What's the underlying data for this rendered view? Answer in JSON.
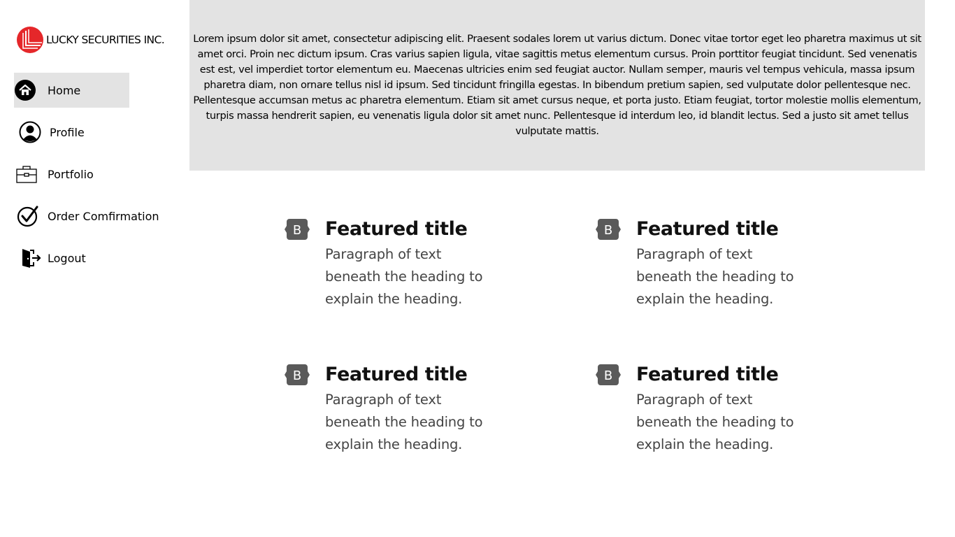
{
  "brand": {
    "name": "LUCKY SECURITIES INC.",
    "accent": "#e5272a"
  },
  "sidebar": {
    "items": [
      {
        "label": "Home",
        "icon": "home-icon",
        "active": true
      },
      {
        "label": "Profile",
        "icon": "user-icon",
        "active": false
      },
      {
        "label": "Portfolio",
        "icon": "briefcase-icon",
        "active": false
      },
      {
        "label": "Order Comfirmation",
        "icon": "check-circle-icon",
        "active": false
      },
      {
        "label": "Logout",
        "icon": "logout-icon",
        "active": false
      }
    ]
  },
  "banner": {
    "text": "Lorem ipsum dolor sit amet, consectetur adipiscing elit. Praesent sodales lorem ut varius dictum. Donec vitae tortor eget leo pharetra maximus ut sit amet orci. Proin nec dictum ipsum. Cras varius sapien ligula, vitae sagittis metus elementum cursus. Proin porttitor feugiat tincidunt. Sed venenatis est est, vel imperdiet tortor elementum eu. Maecenas ultricies enim sed feugiat auctor. Nullam semper, mauris vel tempus vehicula, massa ipsum pharetra diam, non ornare tellus nisl id ipsum. Sed tincidunt fringilla egestas. In bibendum pretium sapien, sed vulputate dolor pellentesque nec. Pellentesque accumsan metus ac pharetra elementum. Etiam sit amet cursus neque, et porta justo. Etiam feugiat, tortor molestie mollis elementum, turpis massa hendrerit sapien, eu venenatis ligula dolor sit amet nunc. Pellentesque id interdum leo, id blandit lectus. Sed a justo sit amet tellus vulputate mattis."
  },
  "features": [
    {
      "icon": "bootstrap-icon",
      "badge": "B",
      "title": "Featured title",
      "text": "Paragraph of text beneath the heading to explain the heading."
    },
    {
      "icon": "bootstrap-icon",
      "badge": "B",
      "title": "Featured title",
      "text": "Paragraph of text beneath the heading to explain the heading."
    },
    {
      "icon": "bootstrap-icon",
      "badge": "B",
      "title": "Featured title",
      "text": "Paragraph of text beneath the heading to explain the heading."
    },
    {
      "icon": "bootstrap-icon",
      "badge": "B",
      "title": "Featured title",
      "text": "Paragraph of text beneath the heading to explain the heading."
    }
  ]
}
